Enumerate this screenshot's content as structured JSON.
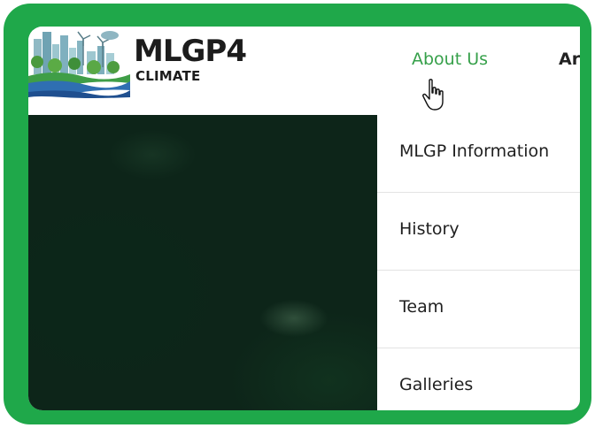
{
  "logo": {
    "title": "MLGP4",
    "subtitle": "CLIMATE"
  },
  "nav": {
    "active": "About Us",
    "next_partial": "Ar"
  },
  "dropdown": {
    "items": [
      {
        "label": "MLGP Information"
      },
      {
        "label": "History"
      },
      {
        "label": "Team"
      },
      {
        "label": "Galleries"
      }
    ]
  },
  "colors": {
    "frame": "#1fa84a",
    "nav_active": "#36a04a",
    "hero": "#0d2519"
  },
  "icons": {
    "cursor": "hand-pointer-icon"
  }
}
